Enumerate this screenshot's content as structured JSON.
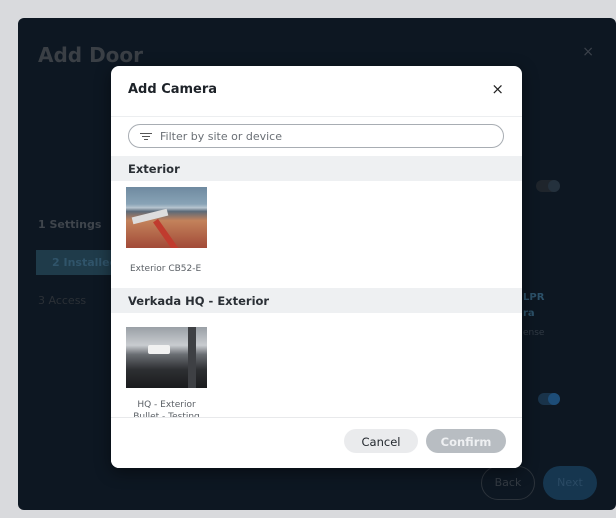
{
  "background": {
    "title": "Add Door",
    "close_icon": "×",
    "steps": [
      "1  Settings",
      "2  Installed",
      "3  Access"
    ],
    "lpr_text": "LPR",
    "lpr_sub": "ra",
    "license_text": "ense",
    "back_label": "Back",
    "next_label": "Next"
  },
  "modal": {
    "title": "Add Camera",
    "close_icon": "×",
    "filter_placeholder": "Filter by site or device",
    "sections": [
      {
        "name": "Exterior",
        "cameras": [
          {
            "label": "Exterior CB52-E"
          }
        ]
      },
      {
        "name": "Verkada HQ - Exterior",
        "cameras": [
          {
            "label": "HQ - Exterior Bullet - Testing"
          }
        ]
      }
    ],
    "cancel_label": "Cancel",
    "confirm_label": "Confirm"
  },
  "colors": {
    "overlay": "#0d1722",
    "confirm_disabled": "#b8bdc2",
    "section_header_bg": "#eef0f2"
  }
}
